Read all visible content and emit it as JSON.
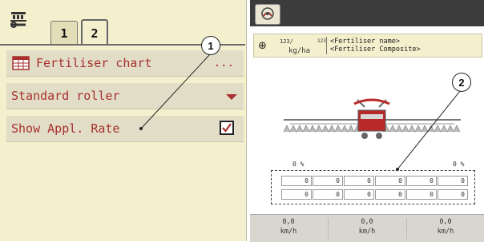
{
  "left_panel": {
    "tabs": [
      "1",
      "2"
    ],
    "active_tab": "2",
    "rows": [
      {
        "label": "Fertiliser chart",
        "trailing": "..."
      },
      {
        "label": "Standard roller",
        "trailing_icon": "dropdown-arrow-icon"
      },
      {
        "label": "Show Appl. Rate",
        "checked": true,
        "checkmark": "✓"
      }
    ],
    "callout": "1"
  },
  "right_panel": {
    "rate_top": "123/",
    "rate_sub": "123",
    "rate_unit": "kg/ha",
    "fertiliser_name": "<Fertiliser name>",
    "fertiliser_composite": "<Fertiliser Composite>",
    "left_percent": "0 %",
    "right_percent": "0 %",
    "rate_cells_row1": [
      "0",
      "0",
      "0",
      "0",
      "0",
      "0"
    ],
    "rate_cells_row2": [
      "0",
      "0",
      "0",
      "0",
      "0",
      "0"
    ],
    "speeds": [
      {
        "value": "0,0",
        "unit": "km/h"
      },
      {
        "value": "0,0",
        "unit": "km/h"
      },
      {
        "value": "0,0",
        "unit": "km/h"
      }
    ],
    "callout": "2"
  },
  "colors": {
    "panel_bg": "#f4efcc",
    "row_bg": "#e1ddc6",
    "text_red": "#a83030",
    "header_dark": "#3c3c3c"
  }
}
